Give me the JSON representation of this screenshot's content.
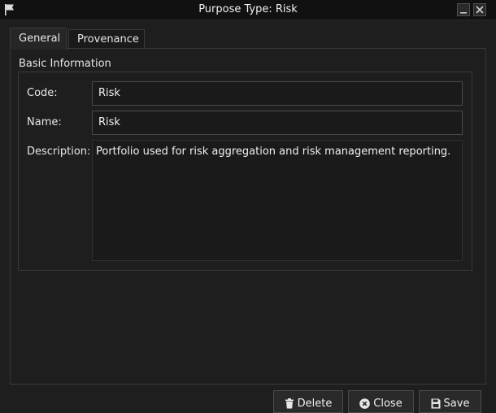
{
  "window": {
    "title": "Purpose Type: Risk",
    "icon": "flag-icon"
  },
  "tabs": [
    {
      "label": "General",
      "active": true
    },
    {
      "label": "Provenance",
      "active": false
    }
  ],
  "group": {
    "title": "Basic Information"
  },
  "fields": {
    "code_label": "Code:",
    "code_value": "Risk",
    "name_label": "Name:",
    "name_value": "Risk",
    "description_label": "Description:",
    "description_value": "Portfolio used for risk aggregation and risk management reporting."
  },
  "buttons": {
    "delete_label": "Delete",
    "close_label": "Close",
    "save_label": "Save"
  }
}
